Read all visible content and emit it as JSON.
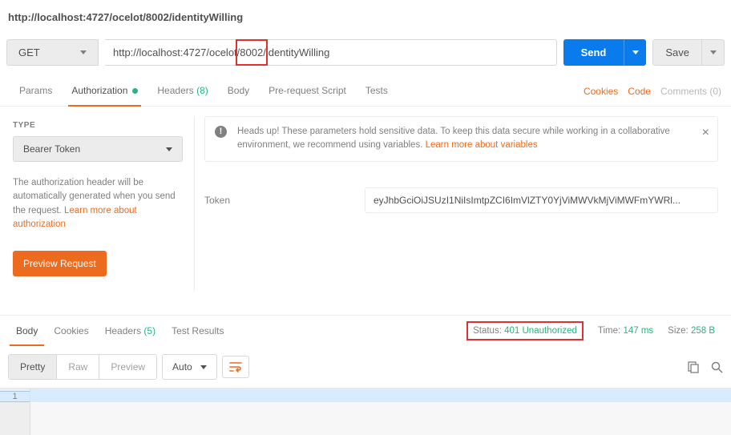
{
  "title": "http://localhost:4727/ocelot/8002/identityWilling",
  "request": {
    "method": "GET",
    "url_prefix": "http://localhost:4727/ocelot",
    "url_highlight": "/8002/",
    "url_suffix": "identityWilling",
    "send_label": "Send",
    "save_label": "Save"
  },
  "tabs": {
    "params": "Params",
    "authorization": "Authorization",
    "headers": "Headers",
    "headers_count": "(8)",
    "body": "Body",
    "prerequest": "Pre-request Script",
    "tests": "Tests"
  },
  "tabs_right": {
    "cookies": "Cookies",
    "code": "Code",
    "comments": "Comments (0)"
  },
  "auth": {
    "type_label": "TYPE",
    "type_value": "Bearer Token",
    "help_text_1": "The authorization header will be automatically generated when you send the request. ",
    "help_link": "Learn more about authorization",
    "preview_label": "Preview Request"
  },
  "banner": {
    "text": "Heads up! These parameters hold sensitive data. To keep this data secure while working in a collaborative environment, we recommend using variables. ",
    "link": "Learn more about variables"
  },
  "token": {
    "label": "Token",
    "value": "eyJhbGciOiJSUzI1NiIsImtpZCI6ImVlZTY0YjViMWVkMjViMWFmYWRl..."
  },
  "response_tabs": {
    "body": "Body",
    "cookies": "Cookies",
    "headers": "Headers",
    "headers_count": "(5)",
    "tests": "Test Results"
  },
  "response_meta": {
    "status_label": "Status:",
    "status_value": "401 Unauthorized",
    "time_label": "Time:",
    "time_value": "147 ms",
    "size_label": "Size:",
    "size_value": "258 B"
  },
  "viewer": {
    "pretty": "Pretty",
    "raw": "Raw",
    "preview": "Preview",
    "lang": "Auto",
    "line1": "1"
  }
}
